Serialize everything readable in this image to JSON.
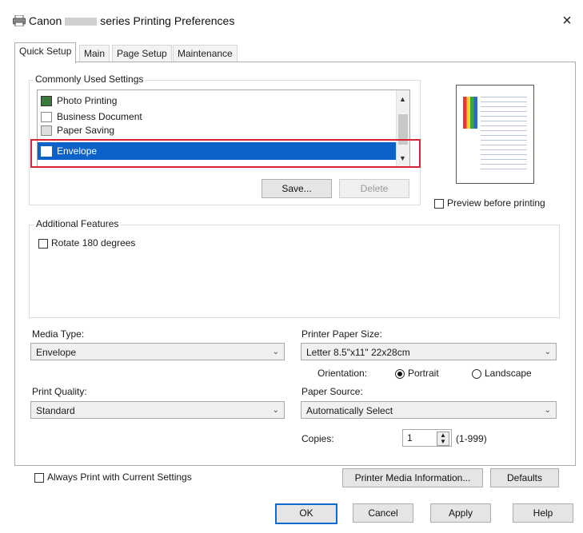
{
  "window": {
    "title_prefix": "Canon",
    "title_suffix": "series Printing Preferences",
    "close_glyph": "×"
  },
  "tabs": [
    {
      "label": "Quick Setup",
      "active": true
    },
    {
      "label": "Main",
      "active": false
    },
    {
      "label": "Page Setup",
      "active": false
    },
    {
      "label": "Maintenance",
      "active": false
    }
  ],
  "commonly_used": {
    "title": "Commonly Used Settings",
    "items": [
      {
        "label": "Photo Printing",
        "icon": "photo-printing-icon"
      },
      {
        "label": "Business Document",
        "icon": "business-document-icon"
      },
      {
        "label": "Paper Saving",
        "icon": "paper-saving-icon"
      },
      {
        "label": "Envelope",
        "icon": "envelope-icon",
        "selected": true
      }
    ],
    "save_label": "Save...",
    "delete_label": "Delete"
  },
  "preview": {
    "label": "Preview before printing",
    "checked": false
  },
  "additional_features": {
    "title": "Additional Features",
    "rotate_label": "Rotate 180 degrees",
    "rotate_checked": false
  },
  "media_type": {
    "label": "Media Type:",
    "value": "Envelope"
  },
  "printer_paper_size": {
    "label": "Printer Paper Size:",
    "value": "Letter 8.5\"x11\" 22x28cm"
  },
  "orientation": {
    "label": "Orientation:",
    "portrait": "Portrait",
    "landscape": "Landscape",
    "selected": "Portrait"
  },
  "print_quality": {
    "label": "Print Quality:",
    "value": "Standard"
  },
  "paper_source": {
    "label": "Paper Source:",
    "value": "Automatically Select"
  },
  "copies": {
    "label": "Copies:",
    "value": "1",
    "range": "(1-999)"
  },
  "always_print": {
    "label": "Always Print with Current Settings",
    "checked": false
  },
  "bottom_buttons": {
    "media_info": "Printer Media Information...",
    "defaults": "Defaults"
  },
  "dialog_buttons": {
    "ok": "OK",
    "cancel": "Cancel",
    "apply": "Apply",
    "help": "Help"
  },
  "colors": {
    "selection": "#0c62c9",
    "highlight_box": "#d82535",
    "ok_border": "#0f6ad0"
  }
}
